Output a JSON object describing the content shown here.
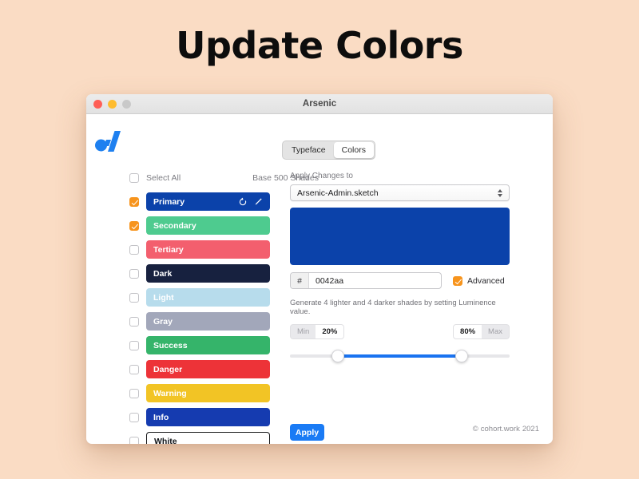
{
  "page": {
    "title": "Update Colors",
    "background_color": "#fadcc4"
  },
  "window": {
    "title": "Arsenic",
    "traffic_lights": [
      {
        "name": "close",
        "color": "#ff5f57"
      },
      {
        "name": "minimize",
        "color": "#febc2e"
      },
      {
        "name": "zoom",
        "color": "#c9c9c9"
      }
    ]
  },
  "tabs": [
    {
      "label": "Typeface",
      "active": false
    },
    {
      "label": "Colors",
      "active": true
    }
  ],
  "left_panel": {
    "select_all_label": "Select All",
    "select_all_checked": false,
    "base_shades_label": "Base 500 Shades",
    "swatches": [
      {
        "label": "Primary",
        "color": "#0b42aa",
        "checked": true,
        "text": "light",
        "outlined": false,
        "icons": [
          "reset-icon",
          "edit-icon"
        ]
      },
      {
        "label": "Secondary",
        "color": "#4ecb8f",
        "checked": true,
        "text": "light",
        "outlined": false,
        "icons": []
      },
      {
        "label": "Tertiary",
        "color": "#f35f6e",
        "checked": false,
        "text": "light",
        "outlined": false,
        "icons": []
      },
      {
        "label": "Dark",
        "color": "#17213f",
        "checked": false,
        "text": "light",
        "outlined": false,
        "icons": []
      },
      {
        "label": "Light",
        "color": "#b7dcec",
        "checked": false,
        "text": "light",
        "outlined": false,
        "icons": []
      },
      {
        "label": "Gray",
        "color": "#a2a7ba",
        "checked": false,
        "text": "light",
        "outlined": false,
        "icons": []
      },
      {
        "label": "Success",
        "color": "#35b46a",
        "checked": false,
        "text": "light",
        "outlined": false,
        "icons": []
      },
      {
        "label": "Danger",
        "color": "#ed3338",
        "checked": false,
        "text": "light",
        "outlined": false,
        "icons": []
      },
      {
        "label": "Warning",
        "color": "#f2c425",
        "checked": false,
        "text": "light",
        "outlined": false,
        "icons": []
      },
      {
        "label": "Info",
        "color": "#153bb0",
        "checked": false,
        "text": "light",
        "outlined": false,
        "icons": []
      },
      {
        "label": "White",
        "color": "#ffffff",
        "checked": false,
        "text": "dark",
        "outlined": true,
        "icons": []
      }
    ]
  },
  "right_panel": {
    "apply_to_label": "Apply Changes to",
    "target_file": "Arsenic-Admin.sketch",
    "preview_color": "#0b42aa",
    "hex_prefix": "#",
    "hex_value": "0042aa",
    "advanced_label": "Advanced",
    "advanced_checked": true,
    "helper_text": "Generate 4 lighter and 4 darker shades by setting Luminence value.",
    "slider": {
      "min_label": "Min",
      "min_value": "20%",
      "max_label": "Max",
      "max_value": "80%",
      "min_percent": 20,
      "max_percent": 80,
      "fill_color": "#1a73f0"
    }
  },
  "actions": {
    "apply_label": "Apply",
    "apply_color": "#1a7bf5"
  },
  "footer": {
    "copyright_symbol": "©",
    "brand": "cohort.work",
    "year": "2021"
  }
}
